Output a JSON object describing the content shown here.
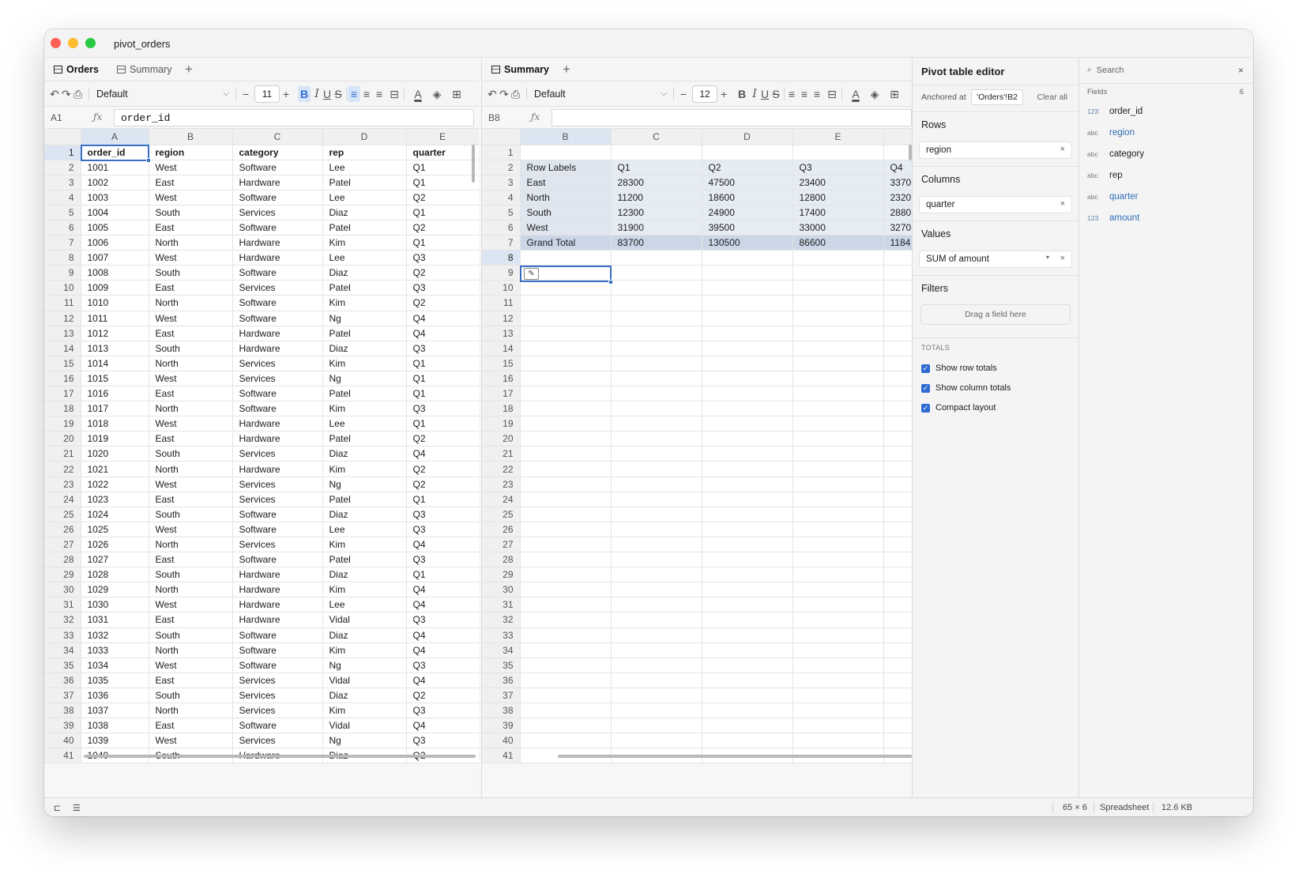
{
  "window": {
    "title": "pivot_orders"
  },
  "left": {
    "tabs": [
      "Orders",
      "Summary"
    ],
    "font": "Default",
    "font_size": "11",
    "cell_ref": "A1",
    "formula": "order_id",
    "columns": [
      "A",
      "B",
      "C",
      "D",
      "E"
    ],
    "rows": [
      [
        "order_id",
        "region",
        "category",
        "rep",
        "quarter"
      ],
      [
        "1001",
        "West",
        "Software",
        "Lee",
        "Q1"
      ],
      [
        "1002",
        "East",
        "Hardware",
        "Patel",
        "Q1"
      ],
      [
        "1003",
        "West",
        "Software",
        "Lee",
        "Q2"
      ],
      [
        "1004",
        "South",
        "Services",
        "Diaz",
        "Q1"
      ],
      [
        "1005",
        "East",
        "Software",
        "Patel",
        "Q2"
      ],
      [
        "1006",
        "North",
        "Hardware",
        "Kim",
        "Q1"
      ],
      [
        "1007",
        "West",
        "Hardware",
        "Lee",
        "Q3"
      ],
      [
        "1008",
        "South",
        "Software",
        "Diaz",
        "Q2"
      ],
      [
        "1009",
        "East",
        "Services",
        "Patel",
        "Q3"
      ],
      [
        "1010",
        "North",
        "Software",
        "Kim",
        "Q2"
      ],
      [
        "1011",
        "West",
        "Software",
        "Ng",
        "Q4"
      ],
      [
        "1012",
        "East",
        "Hardware",
        "Patel",
        "Q4"
      ],
      [
        "1013",
        "South",
        "Hardware",
        "Diaz",
        "Q3"
      ],
      [
        "1014",
        "North",
        "Services",
        "Kim",
        "Q1"
      ],
      [
        "1015",
        "West",
        "Services",
        "Ng",
        "Q1"
      ],
      [
        "1016",
        "East",
        "Software",
        "Patel",
        "Q1"
      ],
      [
        "1017",
        "North",
        "Software",
        "Kim",
        "Q3"
      ],
      [
        "1018",
        "West",
        "Hardware",
        "Lee",
        "Q1"
      ],
      [
        "1019",
        "East",
        "Hardware",
        "Patel",
        "Q2"
      ],
      [
        "1020",
        "South",
        "Services",
        "Diaz",
        "Q4"
      ],
      [
        "1021",
        "North",
        "Hardware",
        "Kim",
        "Q2"
      ],
      [
        "1022",
        "West",
        "Services",
        "Ng",
        "Q2"
      ],
      [
        "1023",
        "East",
        "Services",
        "Patel",
        "Q1"
      ],
      [
        "1024",
        "South",
        "Software",
        "Diaz",
        "Q3"
      ],
      [
        "1025",
        "West",
        "Software",
        "Lee",
        "Q3"
      ],
      [
        "1026",
        "North",
        "Services",
        "Kim",
        "Q4"
      ],
      [
        "1027",
        "East",
        "Software",
        "Patel",
        "Q3"
      ],
      [
        "1028",
        "South",
        "Hardware",
        "Diaz",
        "Q1"
      ],
      [
        "1029",
        "North",
        "Hardware",
        "Kim",
        "Q4"
      ],
      [
        "1030",
        "West",
        "Hardware",
        "Lee",
        "Q4"
      ],
      [
        "1031",
        "East",
        "Hardware",
        "Vidal",
        "Q3"
      ],
      [
        "1032",
        "South",
        "Software",
        "Diaz",
        "Q4"
      ],
      [
        "1033",
        "North",
        "Software",
        "Kim",
        "Q4"
      ],
      [
        "1034",
        "West",
        "Software",
        "Ng",
        "Q3"
      ],
      [
        "1035",
        "East",
        "Services",
        "Vidal",
        "Q4"
      ],
      [
        "1036",
        "South",
        "Services",
        "Diaz",
        "Q2"
      ],
      [
        "1037",
        "North",
        "Services",
        "Kim",
        "Q3"
      ],
      [
        "1038",
        "East",
        "Software",
        "Vidal",
        "Q4"
      ],
      [
        "1039",
        "West",
        "Services",
        "Ng",
        "Q3"
      ],
      [
        "1040",
        "South",
        "Hardware",
        "Diaz",
        "Q2"
      ]
    ]
  },
  "right": {
    "tabs": [
      "Summary"
    ],
    "font": "Default",
    "font_size": "12",
    "cell_ref": "B8",
    "formula": "",
    "columns": [
      "B",
      "C",
      "D",
      "E",
      ""
    ],
    "pivot": [
      [
        "Row Labels",
        "Q1",
        "Q2",
        "Q3",
        "Q4"
      ],
      [
        "East",
        "28300",
        "47500",
        "23400",
        "3370"
      ],
      [
        "North",
        "11200",
        "18600",
        "12800",
        "2320"
      ],
      [
        "South",
        "12300",
        "24900",
        "17400",
        "2880"
      ],
      [
        "West",
        "31900",
        "39500",
        "33000",
        "3270"
      ],
      [
        "Grand Total",
        "83700",
        "130500",
        "86600",
        "1184"
      ]
    ]
  },
  "editor": {
    "title": "Pivot table editor",
    "anchored_label": "Anchored at",
    "anchored_value": "'Orders'!B2",
    "clear_all": "Clear all",
    "rows_label": "Rows",
    "rows_field": "region",
    "columns_label": "Columns",
    "columns_field": "quarter",
    "values_label": "Values",
    "values_field": "SUM of amount",
    "filters_label": "Filters",
    "filters_placeholder": "Drag a field here",
    "totals_label": "TOTALS",
    "options": [
      "Show row totals",
      "Show column totals",
      "Compact layout"
    ]
  },
  "fields": {
    "search_placeholder": "Search",
    "label": "Fields",
    "count": "6",
    "items": [
      {
        "type": "123",
        "name": "order_id",
        "used": false
      },
      {
        "type": "abc",
        "name": "region",
        "used": true
      },
      {
        "type": "abc",
        "name": "category",
        "used": false
      },
      {
        "type": "abc",
        "name": "rep",
        "used": false
      },
      {
        "type": "abc",
        "name": "quarter",
        "used": true
      },
      {
        "type": "123",
        "name": "amount",
        "used": true
      }
    ]
  },
  "status": {
    "dims": "65 × 6",
    "mode": "Spreadsheet",
    "size": "12.6 KB"
  },
  "colors": {
    "accent": "#2f6ad1",
    "selection": "#3a6fc4",
    "pivot_fill": "#e6ecf4",
    "field_used": "#2e6cb5"
  }
}
